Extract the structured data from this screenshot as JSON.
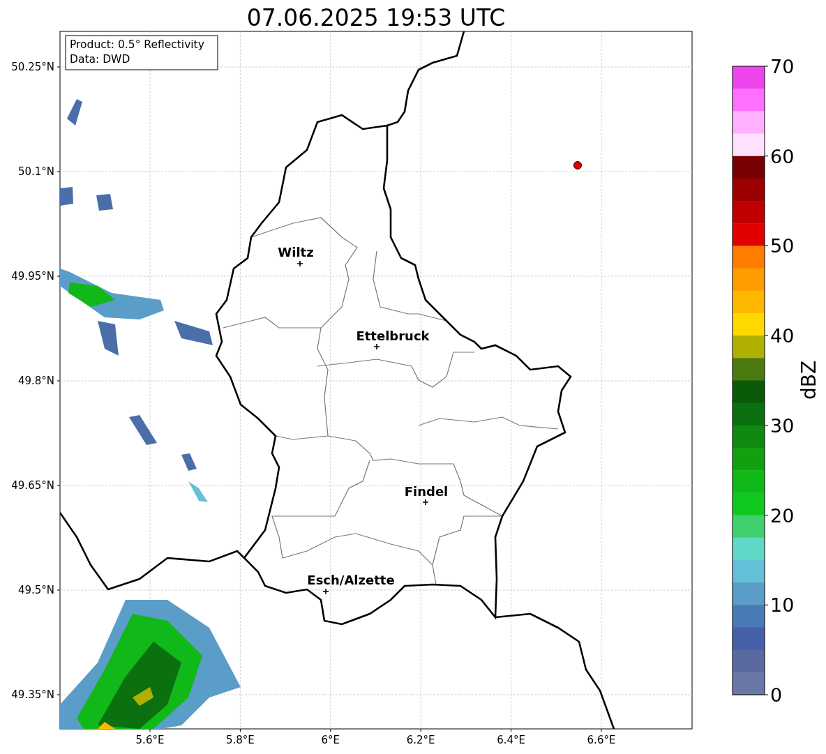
{
  "title": "07.06.2025 19:53 UTC",
  "info_box": [
    "Product: 0.5° Reflectivity",
    "Data: DWD"
  ],
  "lat_ticks": [
    "50.25°N",
    "50.1°N",
    "49.95°N",
    "49.8°N",
    "49.65°N",
    "49.5°N",
    "49.35°N"
  ],
  "lon_ticks": [
    "5.6°E",
    "5.8°E",
    "6°E",
    "6.2°E",
    "6.4°E",
    "6.6°E"
  ],
  "cities": [
    {
      "name": "Wiltz"
    },
    {
      "name": "Ettelbruck"
    },
    {
      "name": "Findel"
    },
    {
      "name": "Esch/Alzette"
    }
  ],
  "colorbar": {
    "label": "dBZ",
    "ticks": [
      "70",
      "60",
      "50",
      "40",
      "30",
      "20",
      "10",
      "0"
    ],
    "segments": [
      {
        "color": "#ee44ee"
      },
      {
        "color": "#ff70ff"
      },
      {
        "color": "#ffb0ff"
      },
      {
        "color": "#ffe0ff"
      },
      {
        "color": "#780000"
      },
      {
        "color": "#9c0000"
      },
      {
        "color": "#c00000"
      },
      {
        "color": "#e00000"
      },
      {
        "color": "#ff7c00"
      },
      {
        "color": "#ff9c00"
      },
      {
        "color": "#ffb800"
      },
      {
        "color": "#ffd800"
      },
      {
        "color": "#b0b000"
      },
      {
        "color": "#4a7a10"
      },
      {
        "color": "#0a5a0a"
      },
      {
        "color": "#0a7010"
      },
      {
        "color": "#0e8a10"
      },
      {
        "color": "#10a010"
      },
      {
        "color": "#10b818"
      },
      {
        "color": "#10c820"
      },
      {
        "color": "#40d070"
      },
      {
        "color": "#60d8c8"
      },
      {
        "color": "#64c0d8"
      },
      {
        "color": "#5a9dc8"
      },
      {
        "color": "#4a7ab5"
      },
      {
        "color": "#4460a8"
      },
      {
        "color": "#5a6aa0"
      },
      {
        "color": "#6a78a8"
      }
    ]
  }
}
